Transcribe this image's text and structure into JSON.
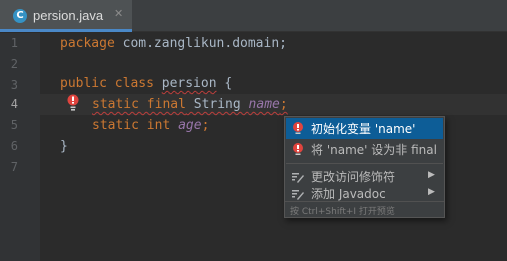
{
  "tab": {
    "icon_letter": "C",
    "label": "persion.java",
    "close_glyph": "✕",
    "icon": "java-class-icon"
  },
  "line_numbers": [
    "1",
    "2",
    "3",
    "4",
    "5",
    "6",
    "7"
  ],
  "code": {
    "line1": {
      "kw": "package",
      "rest": " com.zanglikun.domain;"
    },
    "line3": {
      "kw": "public class",
      "sp": " ",
      "name": "persion",
      "rest": " {"
    },
    "line4": {
      "kw": "static final",
      "type": " String ",
      "field": "name",
      "semi": ";"
    },
    "line5": {
      "kw": "static int",
      "sp": " ",
      "field": "age",
      "semi": ";"
    },
    "line6": {
      "brace": "}"
    }
  },
  "popup": {
    "items": [
      {
        "label": "初始化变量 'name'",
        "icon": "error-bulb-icon",
        "selected": true
      },
      {
        "label": "将 'name' 设为非 final",
        "icon": "error-bulb-icon",
        "selected": false
      },
      {
        "label": "更改访问修饰符",
        "icon": "edit-icon",
        "submenu": "▶"
      },
      {
        "label": "添加 Javadoc",
        "icon": "edit-icon",
        "submenu": "▶"
      }
    ],
    "footer": "按 Ctrl+Shift+I 打开预览"
  },
  "colors": {
    "background": "#2b2b2b",
    "keyword": "#cc7832",
    "field": "#9876aa",
    "error": "#e0443e",
    "selection": "#0d5d97"
  }
}
